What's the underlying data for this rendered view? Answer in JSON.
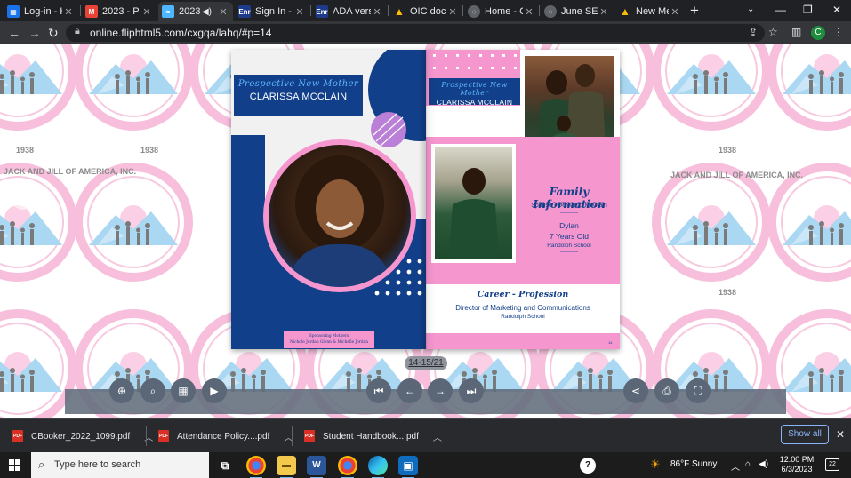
{
  "browser": {
    "tabs": [
      {
        "title": "Log-in - H",
        "favicon": "log-in-icon",
        "color": "#1a73e8",
        "active": false
      },
      {
        "title": "2023 - PN",
        "favicon": "gmail-icon",
        "color": "#ea4335",
        "active": false
      },
      {
        "title": "2023 -",
        "favicon": "flipbook-icon",
        "color": "#4db6ff",
        "active": true
      },
      {
        "title": "Sign In - N",
        "favicon": "enr-icon",
        "color": "#1e3a8a",
        "active": false
      },
      {
        "title": "ADA versi",
        "favicon": "enr-icon",
        "color": "#1e3a8a",
        "active": false
      },
      {
        "title": "OIC docum",
        "favicon": "google-drive-icon",
        "color": "#fbbc04",
        "active": false
      },
      {
        "title": "Home - Ca",
        "favicon": "canvas-icon",
        "color": "#5f6368",
        "active": false
      },
      {
        "title": "June SER S",
        "favicon": "canvas-icon",
        "color": "#5f6368",
        "active": false
      },
      {
        "title": "New Mem",
        "favicon": "google-drive-icon",
        "color": "#fbbc04",
        "active": false
      }
    ],
    "url": "online.fliphtml5.com/cxgqa/lahq/#p=14",
    "profile_initial": "C"
  },
  "flipbook": {
    "left_page": {
      "script_heading": "Prospective New Mother",
      "name": "CLARISSA MCCLAIN",
      "sponsor_title": "Sponsoring Mothers",
      "sponsor_names": "Nichole Jordan Glenn & Michelle Jordan"
    },
    "right_page": {
      "script_heading": "Prospective New Mother",
      "name": "CLARISSA MCCLAIN",
      "family_title": "Family Information",
      "family_lines": [
        "Spouse - DeMarco McClain",
        "----------",
        "Dylan",
        "7 Years Old",
        "Randolph School",
        "----------"
      ],
      "career_title": "Career - Profession",
      "career_role": "Director of Marketing and Communications",
      "career_org": "Randolph School",
      "page_number": "14"
    },
    "page_indicator": "14-15/21",
    "background_watermark": {
      "org": "JACK AND JILL OF AMERICA, INC.",
      "year": "1938"
    }
  },
  "downloads": [
    {
      "name": "CBooker_2022_1099.pdf"
    },
    {
      "name": "Attendance Policy....pdf"
    },
    {
      "name": "Student Handbook....pdf"
    }
  ],
  "downloads_show_all": "Show all",
  "taskbar": {
    "search_placeholder": "Type here to search",
    "weather": "86°F  Sunny",
    "time": "12:00 PM",
    "date": "6/3/2023",
    "notifications": "22"
  },
  "colors": {
    "brand_pink": "#f596cf",
    "brand_navy": "#123f8a",
    "brand_light_blue": "#5fb6ff"
  }
}
